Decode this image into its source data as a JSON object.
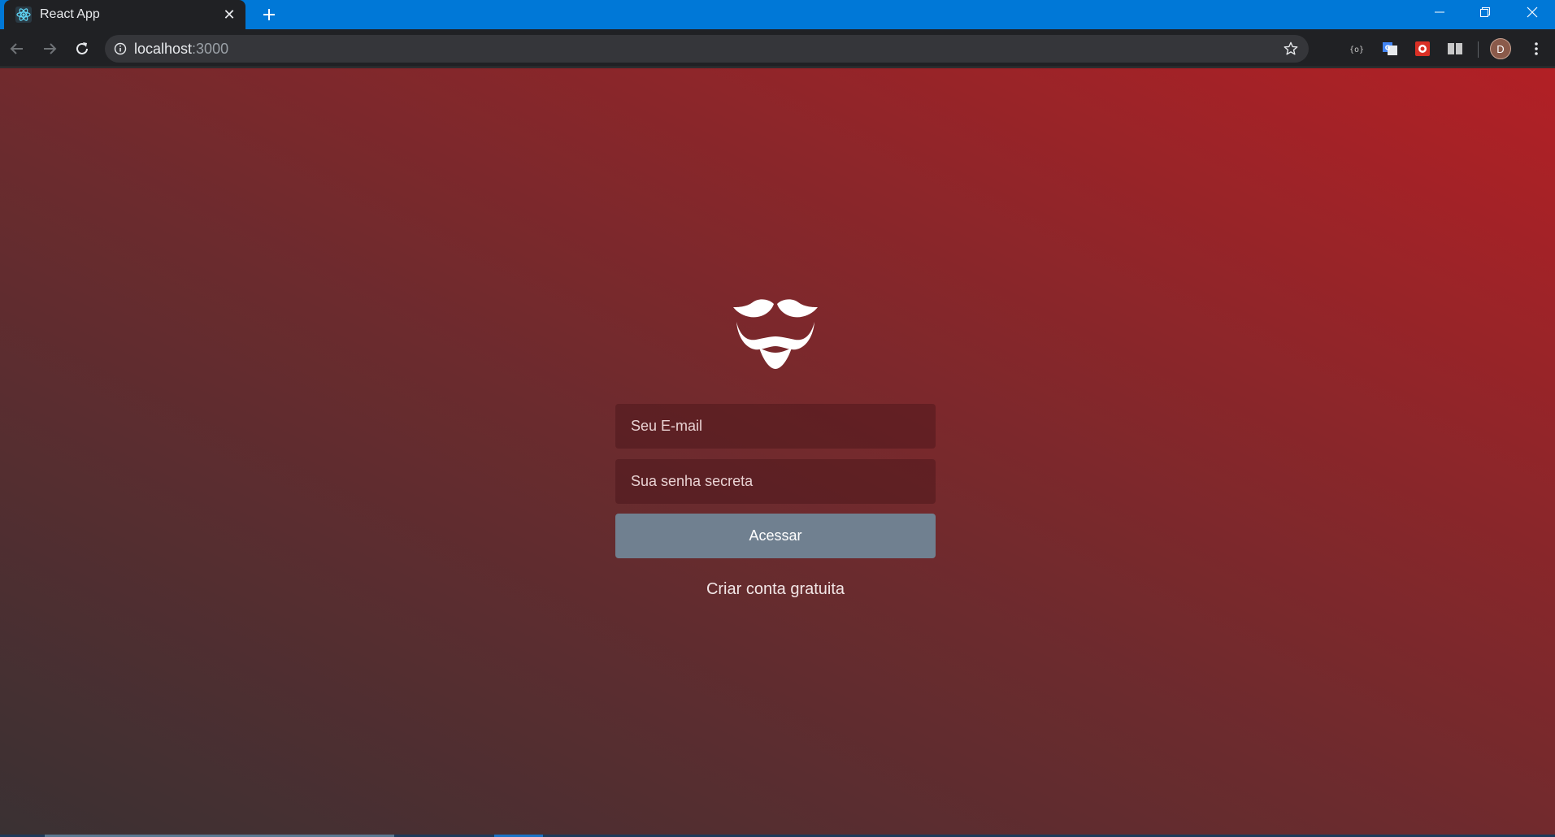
{
  "browser": {
    "tab": {
      "title": "React App",
      "close_glyph": "✕"
    },
    "new_tab_icon": "plus-icon",
    "url": {
      "host": "localhost",
      "port": ":3000"
    },
    "extensions": [
      "code-ext-icon",
      "translate-ext-icon",
      "bug-ext-icon",
      "reader-ext-icon"
    ],
    "profile_initial": "D",
    "accent_color": "#0078d7"
  },
  "login": {
    "logo": "mustache-beard-icon",
    "email_placeholder": "Seu E-mail",
    "password_placeholder": "Sua senha secreta",
    "submit_label": "Acessar",
    "signup_link": "Criar conta gratuita"
  },
  "colors": {
    "background_start": "#3a3133",
    "background_end": "#b22025",
    "button": "#708090"
  }
}
